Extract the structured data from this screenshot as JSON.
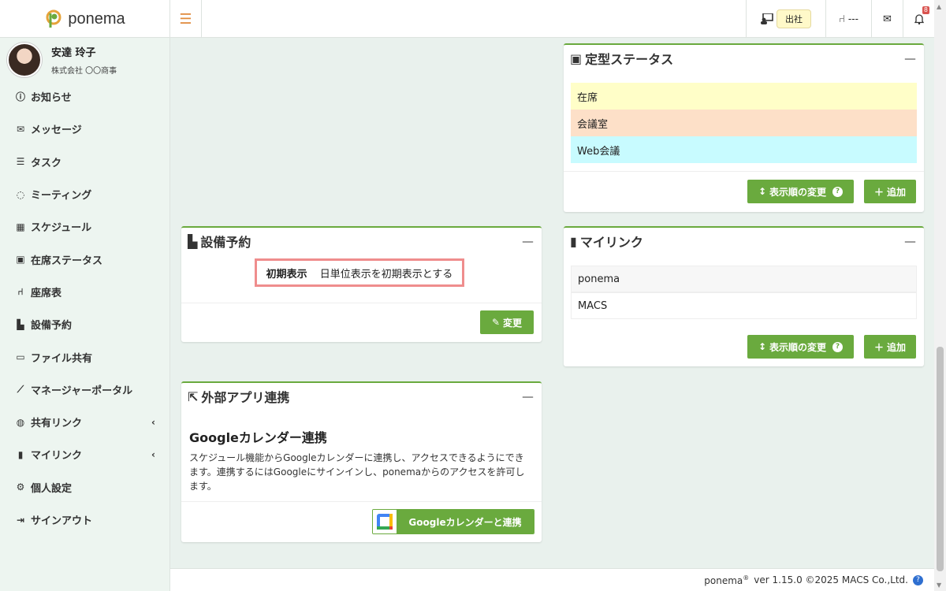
{
  "app": {
    "logo_text": "ponema"
  },
  "topbar": {
    "attendance": "出社",
    "seat": "---",
    "notification_count": "8"
  },
  "user": {
    "name": "安達 玲子",
    "company": "株式会社 〇〇商事"
  },
  "sidebar": {
    "items": [
      {
        "label": "お知らせ",
        "icon": "info-icon"
      },
      {
        "label": "メッセージ",
        "icon": "envelope-icon"
      },
      {
        "label": "タスク",
        "icon": "task-list-icon"
      },
      {
        "label": "ミーティング",
        "icon": "chat-icon"
      },
      {
        "label": "スケジュール",
        "icon": "calendar-icon"
      },
      {
        "label": "在席ステータス",
        "icon": "presence-icon"
      },
      {
        "label": "座席表",
        "icon": "seat-icon"
      },
      {
        "label": "設備予約",
        "icon": "door-icon"
      },
      {
        "label": "ファイル共有",
        "icon": "folder-icon"
      },
      {
        "label": "マネージャーポータル",
        "icon": "chart-icon"
      },
      {
        "label": "共有リンク",
        "icon": "globe-icon"
      },
      {
        "label": "マイリンク",
        "icon": "bookmark-icon"
      },
      {
        "label": "個人設定",
        "icon": "gear-icon"
      },
      {
        "label": "サインアウト",
        "icon": "signout-icon"
      }
    ]
  },
  "status_card": {
    "title": "定型ステータス",
    "rows": [
      {
        "label": "在席",
        "color": "#fffec8"
      },
      {
        "label": "会議室",
        "color": "#fde0c8"
      },
      {
        "label": "Web会議",
        "color": "#c8fbff"
      }
    ],
    "reorder_label": "表示順の変更",
    "add_label": "追加"
  },
  "facility_card": {
    "title": "設備予約",
    "setting_key": "初期表示",
    "setting_value": "日単位表示を初期表示とする",
    "change_label": "変更"
  },
  "mylink_card": {
    "title": "マイリンク",
    "rows": [
      "ponema",
      "MACS"
    ],
    "reorder_label": "表示順の変更",
    "add_label": "追加"
  },
  "external_card": {
    "title": "外部アプリ連携",
    "heading": "Googleカレンダー連携",
    "body": "スケジュール機能からGoogleカレンダーに連携し、アクセスできるようにできます。連携するにはGoogleにサインインし、ponemaからのアクセスを許可します。",
    "link_button": "Googleカレンダーと連携"
  },
  "footer": {
    "brand": "ponema",
    "version": "ver 1.15.0 ©2025 MACS Co.,Ltd."
  },
  "colors": {
    "accent": "#6aaa3e",
    "highlight_border": "#ef8d8d"
  }
}
